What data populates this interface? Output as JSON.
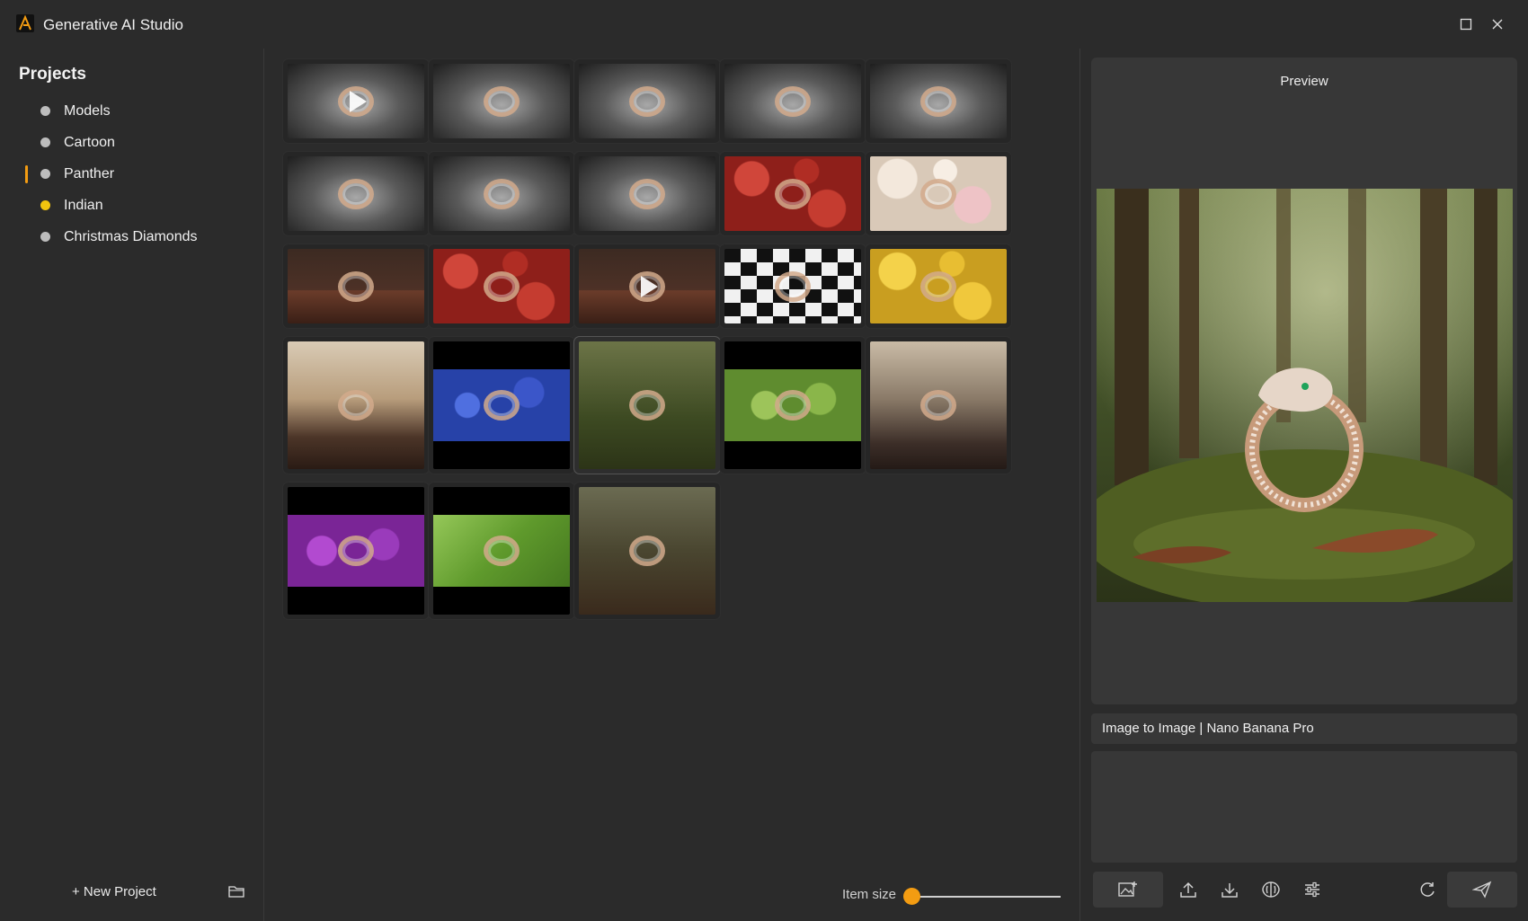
{
  "app": {
    "title": "Generative AI Studio"
  },
  "sidebar": {
    "heading": "Projects",
    "projects": [
      {
        "label": "Models",
        "status_color": "#bdbdbd",
        "active": false
      },
      {
        "label": "Cartoon",
        "status_color": "#bdbdbd",
        "active": false
      },
      {
        "label": "Panther",
        "status_color": "#bdbdbd",
        "active": true
      },
      {
        "label": "Indian",
        "status_color": "#f1c40f",
        "active": false
      },
      {
        "label": "Christmas Diamonds",
        "status_color": "#bdbdbd",
        "active": false
      }
    ],
    "new_project_label": "+ New Project",
    "active_marker_color": "#f39c12"
  },
  "gallery": {
    "item_size_label": "Item size",
    "item_size_value": 0,
    "items": [
      {
        "bg": "gray",
        "video": true
      },
      {
        "bg": "gray",
        "video": false
      },
      {
        "bg": "gray",
        "video": false
      },
      {
        "bg": "gray",
        "video": false
      },
      {
        "bg": "gray",
        "video": false
      },
      {
        "bg": "gray",
        "video": false
      },
      {
        "bg": "gray",
        "video": false
      },
      {
        "bg": "gray",
        "video": false
      },
      {
        "bg": "red-roses",
        "video": false
      },
      {
        "bg": "pastel-roses",
        "video": false
      },
      {
        "bg": "wood-table",
        "video": false
      },
      {
        "bg": "red-roses",
        "video": false
      },
      {
        "bg": "wood-table",
        "video": true
      },
      {
        "bg": "checker",
        "video": false
      },
      {
        "bg": "yellow-roses",
        "video": false
      },
      {
        "bg": "showcase",
        "video": false
      },
      {
        "bg": "blue-flowers",
        "video": false
      },
      {
        "bg": "forest",
        "video": false,
        "selected": true
      },
      {
        "bg": "green-roses",
        "video": false
      },
      {
        "bg": "boutique",
        "video": false
      },
      {
        "bg": "purple-roses",
        "video": false
      },
      {
        "bg": "green-leaves",
        "video": false
      },
      {
        "bg": "forest-autumn",
        "video": false
      }
    ]
  },
  "preview": {
    "title": "Preview",
    "model_label": "Image to Image | Nano Banana Pro",
    "prompt_value": ""
  },
  "toolbar": {
    "icons": [
      "add-image-icon",
      "upload-icon",
      "download-icon",
      "compare-icon",
      "settings-sliders-icon",
      "regenerate-icon",
      "send-icon"
    ]
  },
  "colors": {
    "accent": "#f39c12",
    "background": "#2b2b2b",
    "panel": "#373737"
  }
}
